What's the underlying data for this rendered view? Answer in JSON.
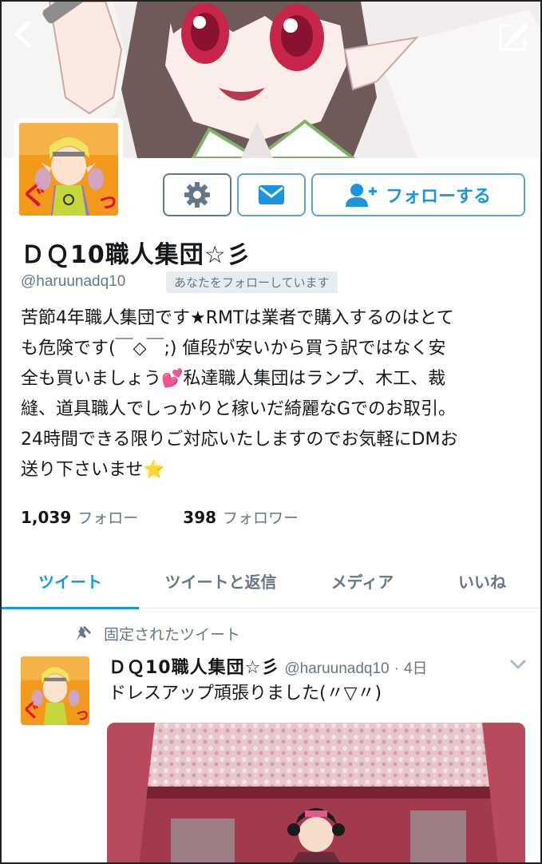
{
  "header": {
    "back_icon": "chevron-left-icon",
    "compose_icon": "compose-quill-icon"
  },
  "profile": {
    "display_name": "ＤＱ10職人集団☆彡",
    "handle": "@haruunadq10",
    "follows_you_badge": "あなたをフォローしています",
    "bio_lines": [
      "苦節4年職人集団です★RMTは業者で購入するのはとて",
      "も危険です(￣◇￣;) 値段が安いから買う訳ではなく安",
      "全も買いましょう💕私達職人集団はランプ、木工、裁",
      "縫、道具職人でしっかりと稼いだ綺麗なGでのお取引。",
      "24時間できる限りご対応いたしますのでお気軽にDMお",
      "送り下さいませ⭐"
    ]
  },
  "actions": {
    "settings_icon": "gear-icon",
    "dm_icon": "envelope-icon",
    "follow_icon": "add-user-icon",
    "follow_label": "フォローする"
  },
  "stats": {
    "following_count": "1,039",
    "following_label": "フォロー",
    "followers_count": "398",
    "followers_label": "フォロワー"
  },
  "tabs": [
    {
      "label": "ツイート",
      "active": true
    },
    {
      "label": "ツイートと返信",
      "active": false
    },
    {
      "label": "メディア",
      "active": false
    },
    {
      "label": "いいね",
      "active": false
    }
  ],
  "pinned_tweet": {
    "pinned_label": "固定されたツイート",
    "pin_icon": "pin-icon",
    "author_name": "ＤＱ10職人集団☆彡",
    "author_handle": "@haruunadq10",
    "separator": "·",
    "time": "4日",
    "text": "ドレスアップ頑張りました(〃▽〃)",
    "caret_icon": "chevron-down-icon"
  },
  "colors": {
    "accent": "#1b95e0",
    "muted": "#657786",
    "border": "#e1e8ed"
  }
}
